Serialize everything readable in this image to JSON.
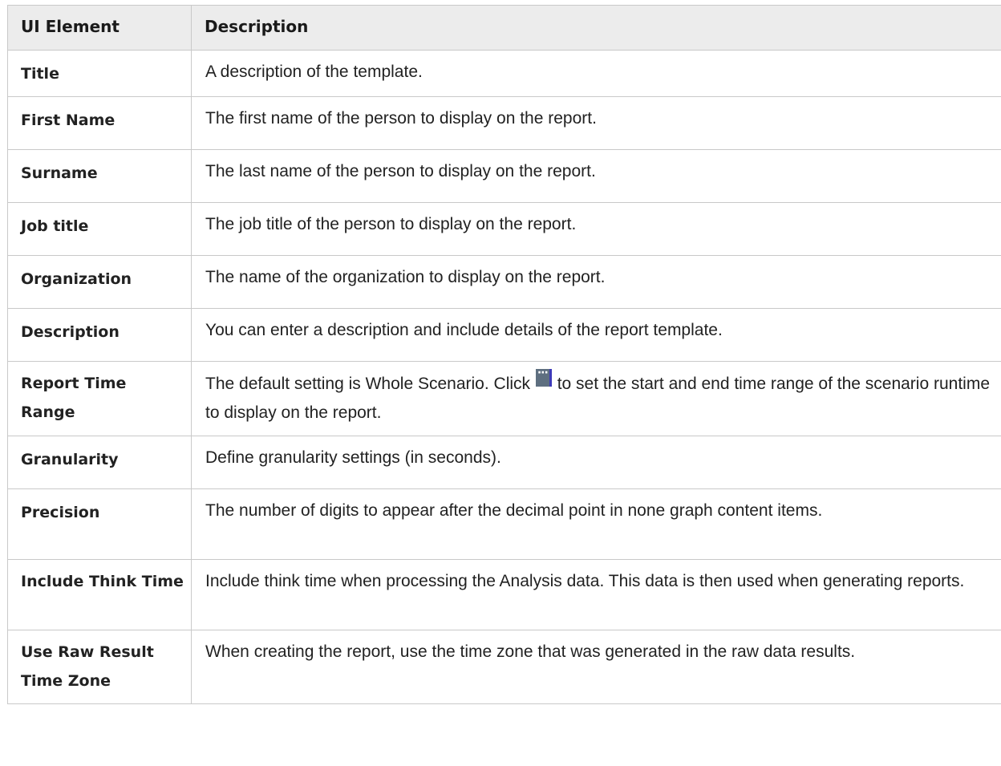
{
  "table": {
    "headers": {
      "element": "UI Element",
      "description": "Description"
    },
    "rows": [
      {
        "element": "Title",
        "description": "A description of the template."
      },
      {
        "element": "First Name",
        "description": "The first name of the person to display on the report."
      },
      {
        "element": "Surname",
        "description": "The last name of the person to display on the report."
      },
      {
        "element": "Job title",
        "description": "The job title of the person to display on the report."
      },
      {
        "element": "Organization",
        "description": "The name of the organization to display on the report."
      },
      {
        "element": "Description",
        "description": "You can enter a description and include details of the report template."
      },
      {
        "element": "Report Time Range",
        "description_before": "The default setting is Whole Scenario. Click ",
        "description_icon": "ellipsis-browse-icon",
        "description_after": " to set the start and end time range of the scenario runtime to display on the report."
      },
      {
        "element": "Granularity",
        "description": "Define granularity settings (in seconds)."
      },
      {
        "element": "Precision",
        "description": "The number of digits to appear after the decimal point in none graph content items."
      },
      {
        "element": "Include Think Time",
        "description": "Include think time when processing the Analysis data. This data is then used when generating reports."
      },
      {
        "element": "Use Raw Result Time Zone",
        "description": "When creating the report, use the time zone that was generated in the raw data results."
      }
    ]
  },
  "colors": {
    "header_bg": "#ececec",
    "border": "#c9c9c9",
    "icon_bg": "#5e6f80",
    "icon_edge": "#3d3ab8"
  }
}
